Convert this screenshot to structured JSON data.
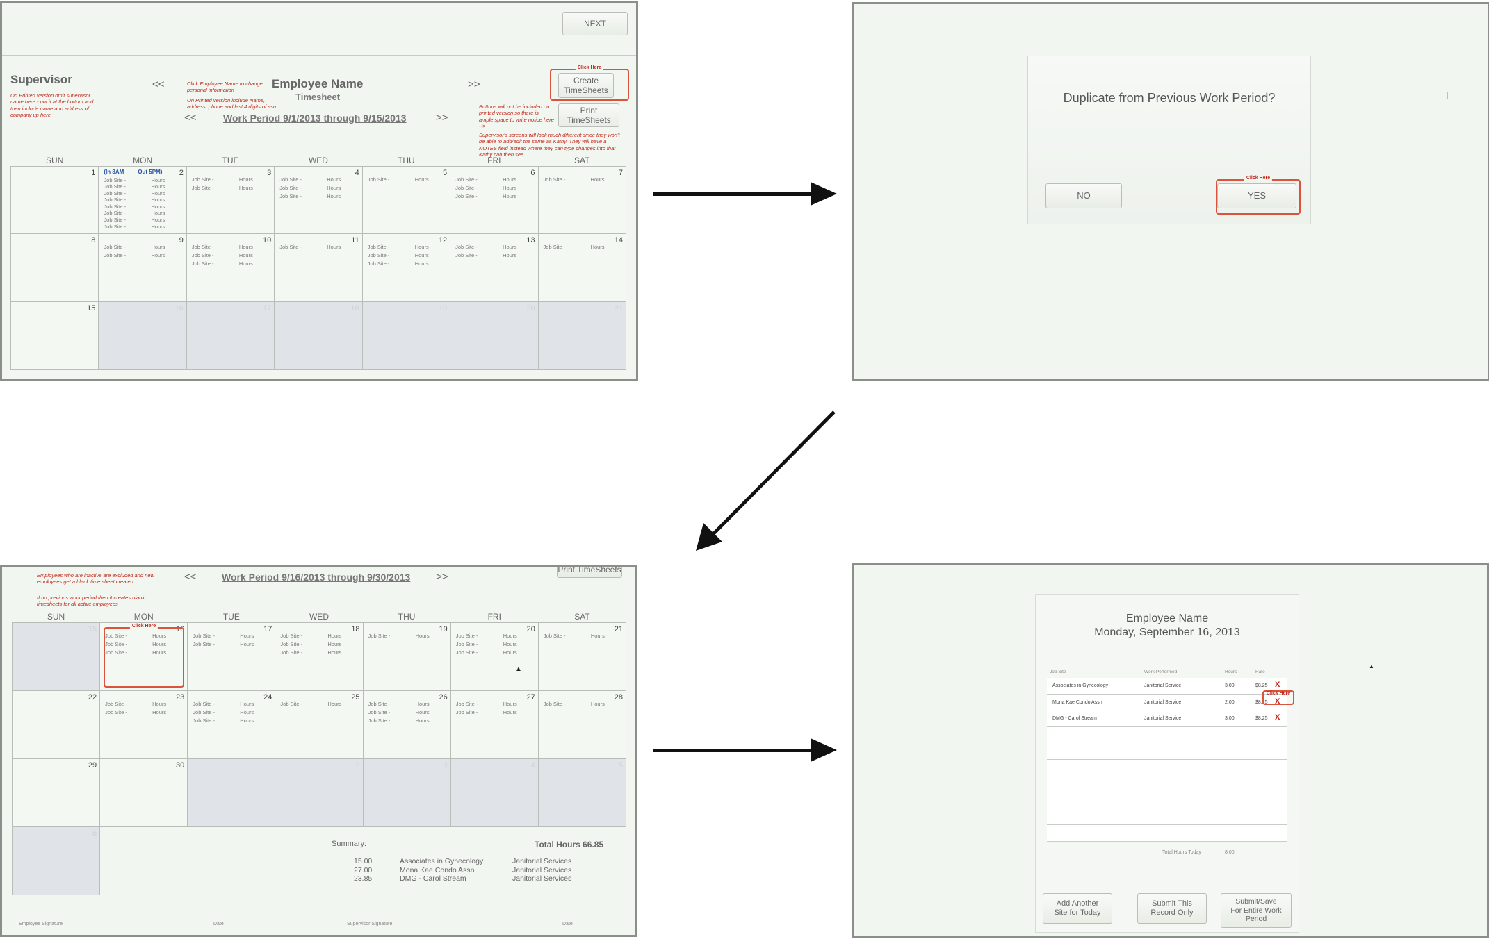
{
  "panel1": {
    "next": "NEXT",
    "supervisor": "Supervisor",
    "sup_note": "On Printed version omit supervisor name here - put it at the bottom and then include name and address of company up here",
    "emp_note": "Click Employee Name to change personal information",
    "emp_note2": "On Printed version include Name, address, phone and last 4 digits of ssn",
    "employee_name": "Employee Name",
    "timesheet": "Timesheet",
    "prev": "<<",
    "next_nav": ">>",
    "work_period": "Work Period 9/1/2013 through 9/15/2013",
    "click_here": "Click Here",
    "create": "Create TimeSheets",
    "print": "Print TimeSheets",
    "buttons_note": "Buttons will not be included on printed version so there is ample space to write notice here -->",
    "supervisor_note": "Supervisor's screens will look much different since they won't be able to add/edit the same as Kathy. They will have a NOTES field instead where they can type changes into that Kathy can then see",
    "days": [
      "SUN",
      "MON",
      "TUE",
      "WED",
      "THU",
      "FRI",
      "SAT"
    ],
    "inout": [
      "(In 8AM",
      "Out 5PM)"
    ],
    "job_site": "Job Site -",
    "hours": "Hours",
    "weeks": [
      [
        {
          "d": "1",
          "n": 0
        },
        {
          "d": "2",
          "n": 8,
          "io": true
        },
        {
          "d": "3",
          "n": 2
        },
        {
          "d": "4",
          "n": 3
        },
        {
          "d": "5",
          "n": 1
        },
        {
          "d": "6",
          "n": 3
        },
        {
          "d": "7",
          "n": 1
        }
      ],
      [
        {
          "d": "8",
          "n": 0
        },
        {
          "d": "9",
          "n": 2
        },
        {
          "d": "10",
          "n": 3
        },
        {
          "d": "11",
          "n": 1
        },
        {
          "d": "12",
          "n": 3
        },
        {
          "d": "13",
          "n": 2
        },
        {
          "d": "14",
          "n": 1
        }
      ],
      [
        {
          "d": "15",
          "n": 0
        },
        {
          "d": "16",
          "n": 0,
          "g": true
        },
        {
          "d": "17",
          "n": 0,
          "g": true
        },
        {
          "d": "18",
          "n": 0,
          "g": true
        },
        {
          "d": "19",
          "n": 0,
          "g": true
        },
        {
          "d": "20",
          "n": 0,
          "g": true
        },
        {
          "d": "21",
          "n": 0,
          "g": true
        }
      ]
    ]
  },
  "panel2": {
    "question": "Duplicate from Previous Work Period?",
    "no": "NO",
    "yes": "YES",
    "click_here": "Click Here"
  },
  "panel3": {
    "inactive_note": "Employees who are inactive are excluded and new employees get a blank time sheet created",
    "no_prev_note": "If no previous work period then it creates blank timesheets for all active employees",
    "prev": "<<",
    "next_nav": ">>",
    "work_period": "Work Period 9/16/2013 through 9/30/2013",
    "print": "Print TimeSheets",
    "click_here": "Click Here",
    "days": [
      "SUN",
      "MON",
      "TUE",
      "WED",
      "THU",
      "FRI",
      "SAT"
    ],
    "job_site": "Job Site -",
    "hours": "Hours",
    "weeks": [
      [
        {
          "d": "15",
          "n": 0,
          "g": true
        },
        {
          "d": "16",
          "n": 3
        },
        {
          "d": "17",
          "n": 2
        },
        {
          "d": "18",
          "n": 3
        },
        {
          "d": "19",
          "n": 1
        },
        {
          "d": "20",
          "n": 3
        },
        {
          "d": "21",
          "n": 1
        }
      ],
      [
        {
          "d": "22",
          "n": 0
        },
        {
          "d": "23",
          "n": 2
        },
        {
          "d": "24",
          "n": 3
        },
        {
          "d": "25",
          "n": 1
        },
        {
          "d": "26",
          "n": 3
        },
        {
          "d": "27",
          "n": 2
        },
        {
          "d": "28",
          "n": 1
        }
      ],
      [
        {
          "d": "29",
          "n": 0
        },
        {
          "d": "30",
          "n": 0
        },
        {
          "d": "1",
          "n": 0,
          "g": true
        },
        {
          "d": "2",
          "n": 0,
          "g": true
        },
        {
          "d": "3",
          "n": 0,
          "g": true
        },
        {
          "d": "4",
          "n": 0,
          "g": true
        },
        {
          "d": "5",
          "n": 0,
          "g": true
        }
      ],
      [
        {
          "d": "6",
          "n": 0,
          "g": true
        }
      ]
    ],
    "summary_label": "Summary:",
    "total_hours": "Total Hours 66.85",
    "summary": [
      {
        "hours": "15.00",
        "site": "Associates in Gynecology",
        "service": "Janitorial Services"
      },
      {
        "hours": "27.00",
        "site": "Mona Kae Condo Assn",
        "service": "Janitorial Services"
      },
      {
        "hours": "23.85",
        "site": "DMG - Carol Stream",
        "service": "Janitorial Services"
      }
    ],
    "sig_employee": "Employee Signature",
    "sig_date": "Date",
    "sig_supervisor": "Supervisor Signature",
    "sig_date2": "Date"
  },
  "panel4": {
    "employee_name": "Employee Name",
    "date": "Monday, September 16, 2013",
    "columns": [
      "Job Site",
      "Work Performed",
      "Hours",
      "Rate"
    ],
    "rows": [
      {
        "site": "Associates in Gynecology",
        "work": "Janitorial Service",
        "hours": "3.00",
        "rate": "$8.25"
      },
      {
        "site": "Mona Kae Condo Assn",
        "work": "Janitorial Service",
        "hours": "2.00",
        "rate": "$8.25"
      },
      {
        "site": "DMG - Carol Stream",
        "work": "Janitorial Service",
        "hours": "3.00",
        "rate": "$8.25"
      }
    ],
    "delete_mark": "X",
    "click_here": "Click Here",
    "total_label": "Total Hours Today",
    "total_value": "8.00",
    "add_site": "Add Another Site for Today",
    "submit_one": "Submit This Record Only",
    "submit_all": "Submit/Save For Entire Work Period"
  }
}
